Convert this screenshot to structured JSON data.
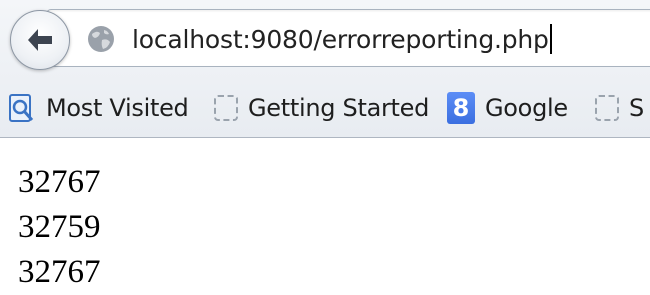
{
  "toolbar": {
    "url": "localhost:9080/errorreporting.php"
  },
  "bookmarks": [
    {
      "label": "Most Visited",
      "icon": "most-visited-icon"
    },
    {
      "label": "Getting Started",
      "icon": "blank-page-icon"
    },
    {
      "label": "Google",
      "icon": "google-icon",
      "icon_text": "8"
    },
    {
      "label": "S",
      "icon": "blank-page-icon"
    }
  ],
  "content": {
    "lines": [
      "32767",
      "32759",
      "32767"
    ]
  }
}
